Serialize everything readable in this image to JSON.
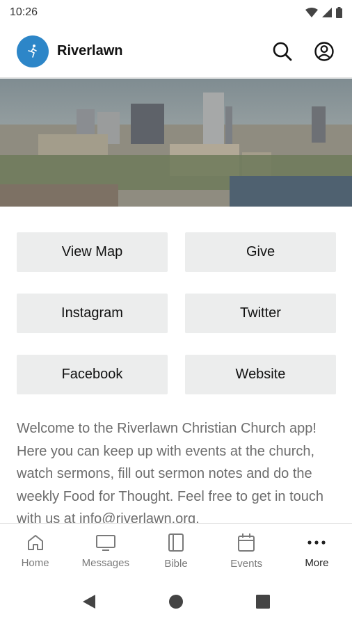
{
  "status_bar": {
    "time": "10:26"
  },
  "app_bar": {
    "title": "Riverlawn"
  },
  "buttons": [
    {
      "label": "View Map"
    },
    {
      "label": "Give"
    },
    {
      "label": "Instagram"
    },
    {
      "label": "Twitter"
    },
    {
      "label": "Facebook"
    },
    {
      "label": "Website"
    }
  ],
  "welcome_text": "Welcome to the Riverlawn Christian Church app! Here you can keep up with events at the church, watch sermons, fill out sermon notes and do the weekly Food for Thought. Feel free to get in touch with us at info@riverlawn.org.",
  "bottom_nav": [
    {
      "label": "Home",
      "icon": "home-icon"
    },
    {
      "label": "Messages",
      "icon": "monitor-icon"
    },
    {
      "label": "Bible",
      "icon": "book-icon"
    },
    {
      "label": "Events",
      "icon": "calendar-icon"
    },
    {
      "label": "More",
      "icon": "more-icon"
    }
  ],
  "colors": {
    "brand": "#2d86c8",
    "button_bg": "#eceded",
    "body_text": "#6d6d6d"
  }
}
